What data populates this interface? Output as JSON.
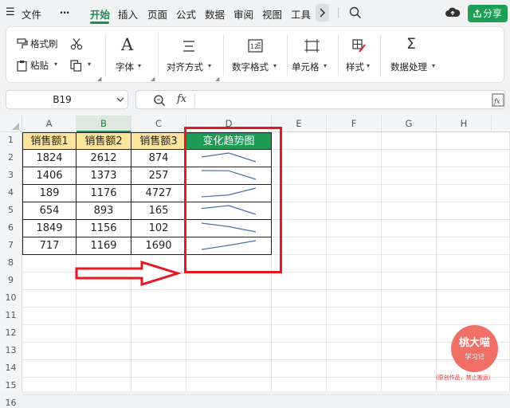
{
  "menu": {
    "hamburger": "☰",
    "file": "文件",
    "more": "⋯",
    "tabs": [
      "开始",
      "插入",
      "页面",
      "公式",
      "数据",
      "审阅",
      "视图",
      "工具"
    ],
    "share": "分享"
  },
  "ribbon": {
    "format_painter": "格式刷",
    "paste": "粘贴",
    "font": "字体",
    "alignment": "对齐方式",
    "number_format": "数字格式",
    "cells": "单元格",
    "styles": "样式",
    "data_processing": "数据处理"
  },
  "formula_bar": {
    "name_box": "B19",
    "fx": "fx",
    "formula": ""
  },
  "sheet": {
    "columns": [
      "A",
      "B",
      "C",
      "D",
      "E",
      "F",
      "G",
      "H"
    ],
    "rows": [
      "1",
      "2",
      "3",
      "4",
      "5",
      "6",
      "7",
      "8",
      "9",
      "10",
      "11",
      "12",
      "13",
      "14",
      "15",
      "16"
    ],
    "headers": [
      "销售额1",
      "销售额2",
      "销售额3",
      "变化趋势图"
    ],
    "data": [
      [
        "1824",
        "2612",
        "874"
      ],
      [
        "1406",
        "1373",
        "257"
      ],
      [
        "189",
        "1176",
        "4727"
      ],
      [
        "654",
        "893",
        "165"
      ],
      [
        "1849",
        "1156",
        "102"
      ],
      [
        "717",
        "1169",
        "1690"
      ]
    ],
    "sparklines": [
      [
        1824,
        2612,
        874
      ],
      [
        1406,
        1373,
        257
      ],
      [
        189,
        1176,
        4727
      ],
      [
        654,
        893,
        165
      ],
      [
        1849,
        1156,
        102
      ],
      [
        717,
        1169,
        1690
      ]
    ]
  },
  "watermark": {
    "line1": "桃大喵",
    "line2": "学习记",
    "note": "(原创作品，禁止搬运)"
  },
  "colors": {
    "accent": "#1e9e57",
    "header_fill": "#fde49c",
    "highlight": "#e8191e",
    "sparkline": "#4a6fa5"
  }
}
